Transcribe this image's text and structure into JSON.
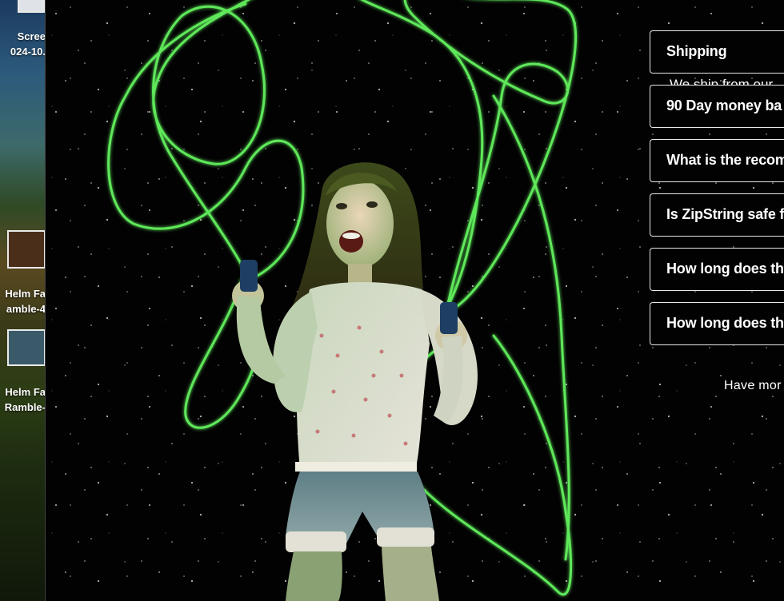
{
  "desktop": {
    "items": [
      {
        "icon": "screenshot-file-icon",
        "line1": "Scree",
        "line2": "024-10."
      },
      {
        "icon": "video-file-icon",
        "line1": "Helm Fa",
        "line2": "amble-4"
      },
      {
        "icon": "video-file-icon",
        "line1": "Helm Fa",
        "line2": "Ramble-"
      }
    ]
  },
  "faq": {
    "items": [
      {
        "question": "Shipping"
      },
      {
        "question": "90 Day money ba"
      },
      {
        "question": "What is the recom"
      },
      {
        "question": "Is ZipString safe f"
      },
      {
        "question": "How long does th"
      },
      {
        "question": "How long does th"
      }
    ],
    "expanded_answer": "We ship from our",
    "more_text": "Have mor"
  },
  "colors": {
    "string_green": "#5ee85a",
    "background": "#020202",
    "border": "#e8e8e8"
  }
}
